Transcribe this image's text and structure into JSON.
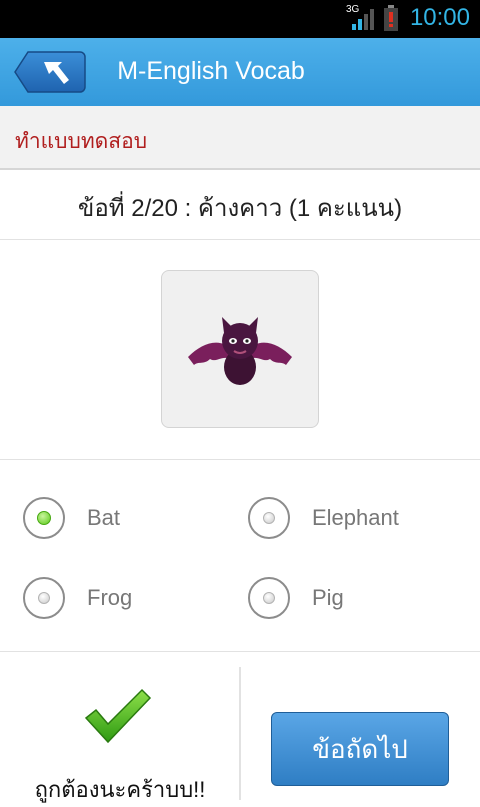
{
  "status_bar": {
    "network": "3G",
    "time": "10:00",
    "signal_icon": "signal-bars-icon",
    "battery_icon": "battery-alert-icon"
  },
  "header": {
    "title": "M-English Vocab",
    "back_icon": "back-arrow-icon",
    "color": "#3ea4e2"
  },
  "section": {
    "title": "ทำแบบทดสอบ",
    "color": "#b01e1e"
  },
  "question": {
    "text": "ข้อที่ 2/20 : ค้างคาว (1 คะแนน)",
    "image_icon": "bat-image"
  },
  "options": [
    {
      "label": "Bat",
      "selected": true
    },
    {
      "label": "Elephant",
      "selected": false
    },
    {
      "label": "Frog",
      "selected": false
    },
    {
      "label": "Pig",
      "selected": false
    }
  ],
  "result": {
    "icon": "check-mark-icon",
    "text": "ถูกต้องนะคร้าบบ!!"
  },
  "next_button": {
    "label": "ข้อถัดไป"
  }
}
